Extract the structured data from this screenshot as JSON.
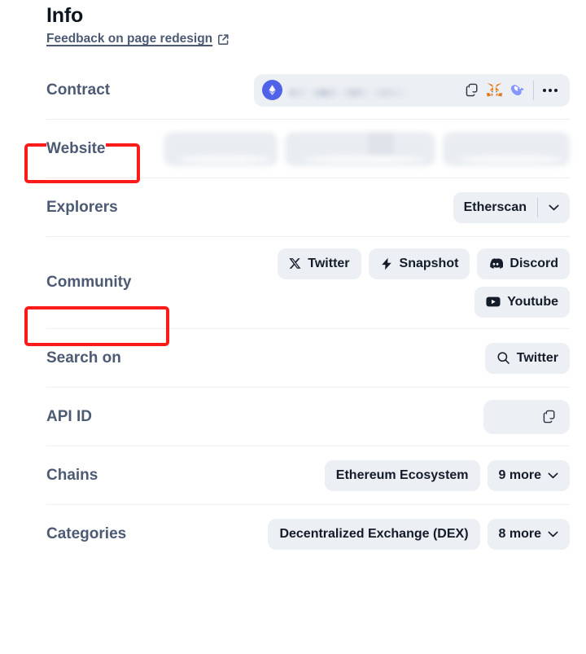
{
  "header": {
    "title": "Info",
    "feedback_link": "Feedback on page redesign",
    "external_icon": "external-link-icon"
  },
  "rows": {
    "contract": {
      "label": "Contract",
      "chain_icon": "ethereum-icon",
      "address": "",
      "copy_icon": "copy-icon",
      "metamask_icon": "metamask-fox-icon",
      "wallet_icon": "rabby-wallet-icon",
      "more_icon": "more-horizontal-icon"
    },
    "website": {
      "label": "Website",
      "links": [
        "",
        "",
        ""
      ]
    },
    "explorers": {
      "label": "Explorers",
      "selected": "Etherscan",
      "chevron_icon": "chevron-down-icon"
    },
    "community": {
      "label": "Community",
      "links": [
        {
          "label": "Twitter",
          "icon": "x-twitter-icon"
        },
        {
          "label": "Snapshot",
          "icon": "lightning-bolt-icon"
        },
        {
          "label": "Discord",
          "icon": "discord-icon"
        },
        {
          "label": "Youtube",
          "icon": "youtube-icon"
        }
      ]
    },
    "search_on": {
      "label": "Search on",
      "target": "Twitter",
      "icon": "search-icon"
    },
    "api_id": {
      "label": "API ID",
      "value": "",
      "copy_icon": "copy-icon"
    },
    "chains": {
      "label": "Chains",
      "primary": "Ethereum Ecosystem",
      "more": "9 more",
      "chevron_icon": "chevron-down-icon"
    },
    "categories": {
      "label": "Categories",
      "primary": "Decentralized Exchange (DEX)",
      "more": "8 more",
      "chevron_icon": "chevron-down-icon"
    }
  },
  "annotations": [
    {
      "target": "Website",
      "color": "#fc1b1b"
    },
    {
      "target": "Community",
      "color": "#fc1b1b"
    }
  ],
  "colors": {
    "label": "#4d5a74",
    "title": "#0d1421",
    "pill_bg": "#eceff3",
    "pill_text": "#141b29",
    "divider": "#eceef2",
    "annotation": "#fc1b1b",
    "ethereum": "#4f62e8"
  }
}
